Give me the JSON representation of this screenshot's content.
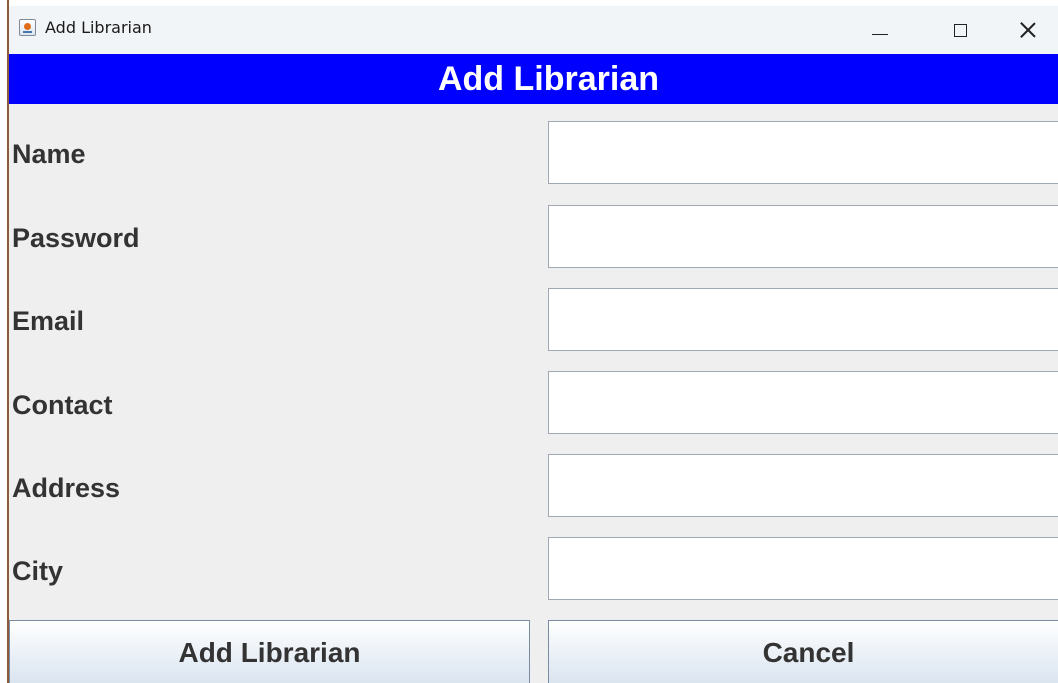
{
  "window": {
    "title": "Add Librarian",
    "icon": "java-cup-icon"
  },
  "header": {
    "title": "Add Librarian",
    "background": "#0000ff",
    "color": "#ffffff"
  },
  "form": {
    "fields": [
      {
        "label": "Name",
        "value": "",
        "placeholder": ""
      },
      {
        "label": "Password",
        "value": "",
        "placeholder": ""
      },
      {
        "label": "Email",
        "value": "",
        "placeholder": ""
      },
      {
        "label": "Contact",
        "value": "",
        "placeholder": ""
      },
      {
        "label": "Address",
        "value": "",
        "placeholder": ""
      },
      {
        "label": "City",
        "value": "",
        "placeholder": ""
      }
    ]
  },
  "buttons": {
    "add_label": "Add Librarian",
    "cancel_label": "Cancel"
  }
}
